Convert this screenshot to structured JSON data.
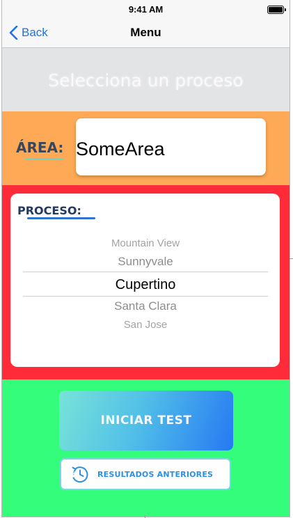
{
  "status_bar": {
    "time": "9:41 AM"
  },
  "nav": {
    "back_label": "Back",
    "title": "Menu"
  },
  "header": {
    "heading": "Selecciona un proceso"
  },
  "area": {
    "label": "ÁREA:",
    "value": "SomeArea"
  },
  "proceso": {
    "label": "PROCESO:",
    "options": [
      "Mountain View",
      "Sunnyvale",
      "Cupertino",
      "Santa Clara",
      "San Jose"
    ],
    "selected": "Cupertino"
  },
  "actions": {
    "start_label": "INICIAR TEST",
    "history_label": "RESULTADOS ANTERIORES",
    "history_icon": "clock-history-icon"
  },
  "colors": {
    "header_bg": "#e3e4e6",
    "area_bg": "#fea955",
    "proceso_bg": "#ff2b38",
    "action_bg": "#33fd7a",
    "accent_blue": "#2679f2",
    "ios_blue": "#1a73e8"
  }
}
